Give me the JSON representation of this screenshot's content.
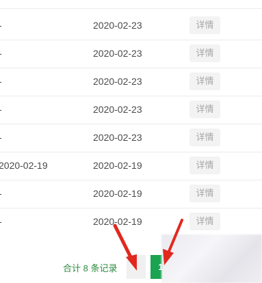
{
  "table": {
    "rows": [
      {
        "col1": "-",
        "col2": "2020-02-23",
        "action": "详情"
      },
      {
        "col1": "-",
        "col2": "2020-02-23",
        "action": "详情"
      },
      {
        "col1": "-",
        "col2": "2020-02-23",
        "action": "详情"
      },
      {
        "col1": "-",
        "col2": "2020-02-23",
        "action": "详情"
      },
      {
        "col1": "-",
        "col2": "2020-02-23",
        "action": "详情"
      },
      {
        "col1": "2020-02-19",
        "col2": "2020-02-19",
        "action": "详情"
      },
      {
        "col1": "-",
        "col2": "2020-02-19",
        "action": "详情"
      },
      {
        "col1": "-",
        "col2": "2020-02-19",
        "action": "详情"
      }
    ]
  },
  "pagination": {
    "total_text": "合计 8 条记录",
    "prev_label": "‹",
    "current_page": "1"
  },
  "colors": {
    "accent": "#1aa350",
    "total_text": "#2d8a3e",
    "annotation_arrow": "#e0281e"
  }
}
